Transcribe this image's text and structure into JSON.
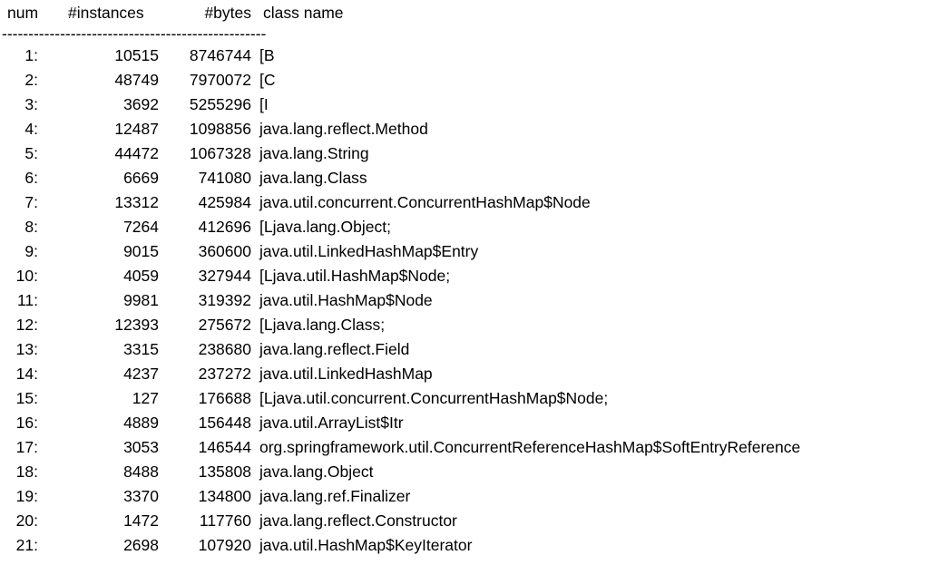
{
  "header": {
    "num": "num",
    "instances": "#instances",
    "bytes": "#bytes",
    "class_name": "class name"
  },
  "separator": "--------------------------------------------------",
  "rows": [
    {
      "num": "1:",
      "instances": "10515",
      "bytes": "8746744",
      "class_name": "[B"
    },
    {
      "num": "2:",
      "instances": "48749",
      "bytes": "7970072",
      "class_name": "[C"
    },
    {
      "num": "3:",
      "instances": "3692",
      "bytes": "5255296",
      "class_name": "[I"
    },
    {
      "num": "4:",
      "instances": "12487",
      "bytes": "1098856",
      "class_name": "java.lang.reflect.Method"
    },
    {
      "num": "5:",
      "instances": "44472",
      "bytes": "1067328",
      "class_name": "java.lang.String"
    },
    {
      "num": "6:",
      "instances": "6669",
      "bytes": "741080",
      "class_name": "java.lang.Class"
    },
    {
      "num": "7:",
      "instances": "13312",
      "bytes": "425984",
      "class_name": "java.util.concurrent.ConcurrentHashMap$Node"
    },
    {
      "num": "8:",
      "instances": "7264",
      "bytes": "412696",
      "class_name": "[Ljava.lang.Object;"
    },
    {
      "num": "9:",
      "instances": "9015",
      "bytes": "360600",
      "class_name": "java.util.LinkedHashMap$Entry"
    },
    {
      "num": "10:",
      "instances": "4059",
      "bytes": "327944",
      "class_name": "[Ljava.util.HashMap$Node;"
    },
    {
      "num": "11:",
      "instances": "9981",
      "bytes": "319392",
      "class_name": "java.util.HashMap$Node"
    },
    {
      "num": "12:",
      "instances": "12393",
      "bytes": "275672",
      "class_name": "[Ljava.lang.Class;"
    },
    {
      "num": "13:",
      "instances": "3315",
      "bytes": "238680",
      "class_name": "java.lang.reflect.Field"
    },
    {
      "num": "14:",
      "instances": "4237",
      "bytes": "237272",
      "class_name": "java.util.LinkedHashMap"
    },
    {
      "num": "15:",
      "instances": "127",
      "bytes": "176688",
      "class_name": "[Ljava.util.concurrent.ConcurrentHashMap$Node;"
    },
    {
      "num": "16:",
      "instances": "4889",
      "bytes": "156448",
      "class_name": "java.util.ArrayList$Itr"
    },
    {
      "num": "17:",
      "instances": "3053",
      "bytes": "146544",
      "class_name": "org.springframework.util.ConcurrentReferenceHashMap$SoftEntryReference"
    },
    {
      "num": "18:",
      "instances": "8488",
      "bytes": "135808",
      "class_name": "java.lang.Object"
    },
    {
      "num": "19:",
      "instances": "3370",
      "bytes": "134800",
      "class_name": "java.lang.ref.Finalizer"
    },
    {
      "num": "20:",
      "instances": "1472",
      "bytes": "117760",
      "class_name": "java.lang.reflect.Constructor"
    },
    {
      "num": "21:",
      "instances": "2698",
      "bytes": "107920",
      "class_name": "java.util.HashMap$KeyIterator"
    }
  ]
}
